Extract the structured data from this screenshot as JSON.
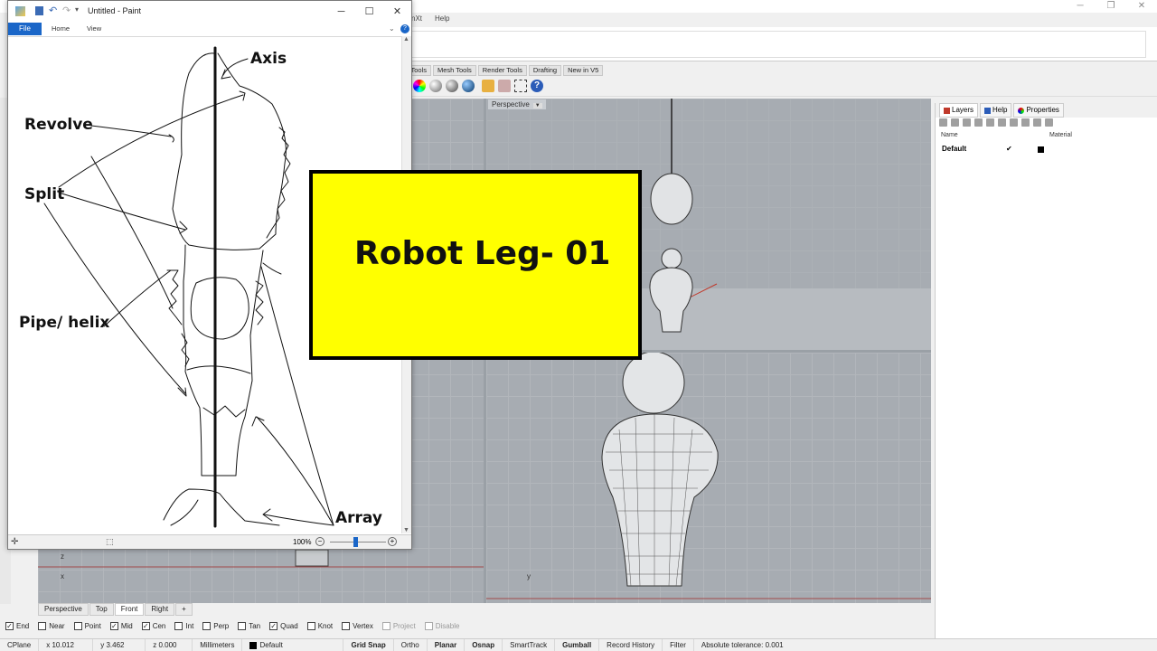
{
  "rhino": {
    "menu": [
      "nXt",
      "Help"
    ],
    "toolbar_tabs": [
      "lid Tools",
      "Mesh Tools",
      "Render Tools",
      "Drafting",
      "New in V5"
    ],
    "viewports": {
      "top_left": {
        "label": ""
      },
      "top_right": {
        "label": "Perspective"
      },
      "bottom_left": {
        "label": ""
      },
      "bottom_right": {
        "label": ""
      }
    },
    "viewport_tabs": [
      "Perspective",
      "Top",
      "Front",
      "Right"
    ],
    "osnaps": [
      {
        "label": "End",
        "checked": true,
        "enabled": true
      },
      {
        "label": "Near",
        "checked": false,
        "enabled": true
      },
      {
        "label": "Point",
        "checked": false,
        "enabled": true
      },
      {
        "label": "Mid",
        "checked": true,
        "enabled": true
      },
      {
        "label": "Cen",
        "checked": true,
        "enabled": true
      },
      {
        "label": "Int",
        "checked": false,
        "enabled": true
      },
      {
        "label": "Perp",
        "checked": false,
        "enabled": true
      },
      {
        "label": "Tan",
        "checked": false,
        "enabled": true
      },
      {
        "label": "Quad",
        "checked": true,
        "enabled": true
      },
      {
        "label": "Knot",
        "checked": false,
        "enabled": true
      },
      {
        "label": "Vertex",
        "checked": false,
        "enabled": true
      },
      {
        "label": "Project",
        "checked": false,
        "enabled": false
      },
      {
        "label": "Disable",
        "checked": false,
        "enabled": false
      }
    ],
    "status": {
      "cplane": "CPlane",
      "x": "x 10.012",
      "y": "y 3.462",
      "z": "z 0.000",
      "units": "Millimeters",
      "layer": "Default",
      "grid_snap": "Grid Snap",
      "ortho": "Ortho",
      "planar": "Planar",
      "osnap": "Osnap",
      "smarttrack": "SmartTrack",
      "gumball": "Gumball",
      "record_history": "Record History",
      "filter": "Filter",
      "tolerance": "Absolute tolerance: 0.001"
    },
    "panel": {
      "tabs": [
        "Layers",
        "Help",
        "Properties"
      ],
      "columns": {
        "name": "Name",
        "material": "Material"
      },
      "layer_row": {
        "name": "Default",
        "check": "✔"
      }
    }
  },
  "paint": {
    "title": "Untitled - Paint",
    "ribbon": {
      "file": "File",
      "home": "Home",
      "view": "View"
    },
    "zoom": "100%",
    "labels": {
      "axis": "Axis",
      "revolve": "Revolve",
      "split": "Split",
      "pipe": "Pipe/ helix",
      "array": "Array"
    }
  },
  "overlay": {
    "title": "Robot Leg- 01"
  },
  "colors": {
    "overlay_bg": "#ffff00",
    "paint_file_tab": "#1a66c8"
  }
}
